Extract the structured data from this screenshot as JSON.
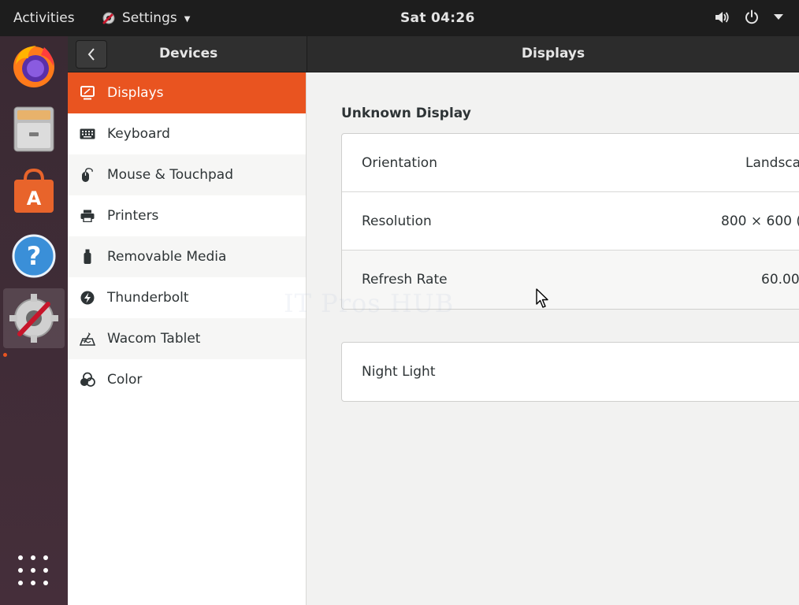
{
  "topbar": {
    "activities": "Activities",
    "app_name": "Settings",
    "clock": "Sat 04:26"
  },
  "dock": {
    "items": [
      {
        "name": "Firefox",
        "icon": "firefox-icon"
      },
      {
        "name": "Files",
        "icon": "files-icon"
      },
      {
        "name": "Ubuntu Software",
        "icon": "software-icon"
      },
      {
        "name": "Help",
        "icon": "help-icon"
      },
      {
        "name": "Settings",
        "icon": "settings-icon",
        "active": true
      }
    ],
    "show_apps_icon": "apps-grid-icon"
  },
  "left_header": {
    "title": "Devices"
  },
  "right_header": {
    "title": "Displays"
  },
  "sidebar": {
    "items": [
      {
        "label": "Displays",
        "icon": "display-icon",
        "selected": true
      },
      {
        "label": "Keyboard",
        "icon": "keyboard-icon"
      },
      {
        "label": "Mouse & Touchpad",
        "icon": "mouse-icon"
      },
      {
        "label": "Printers",
        "icon": "printer-icon"
      },
      {
        "label": "Removable Media",
        "icon": "usb-icon"
      },
      {
        "label": "Thunderbolt",
        "icon": "thunderbolt-icon"
      },
      {
        "label": "Wacom Tablet",
        "icon": "tablet-icon"
      },
      {
        "label": "Color",
        "icon": "color-icon"
      }
    ]
  },
  "content": {
    "section_title": "Unknown Display",
    "rows": [
      {
        "label": "Orientation",
        "value": "Landsca"
      },
      {
        "label": "Resolution",
        "value": "800 × 600 (4"
      },
      {
        "label": "Refresh Rate",
        "value": "60.00"
      }
    ],
    "night_light": {
      "label": "Night Light"
    }
  },
  "watermark": "IT Pros HUB",
  "colors": {
    "accent": "#e95420",
    "topbar": "#1d1d1d",
    "headerbar": "#2c2c2c",
    "dock": "#3d2b35",
    "background": "#f2f2f1"
  }
}
